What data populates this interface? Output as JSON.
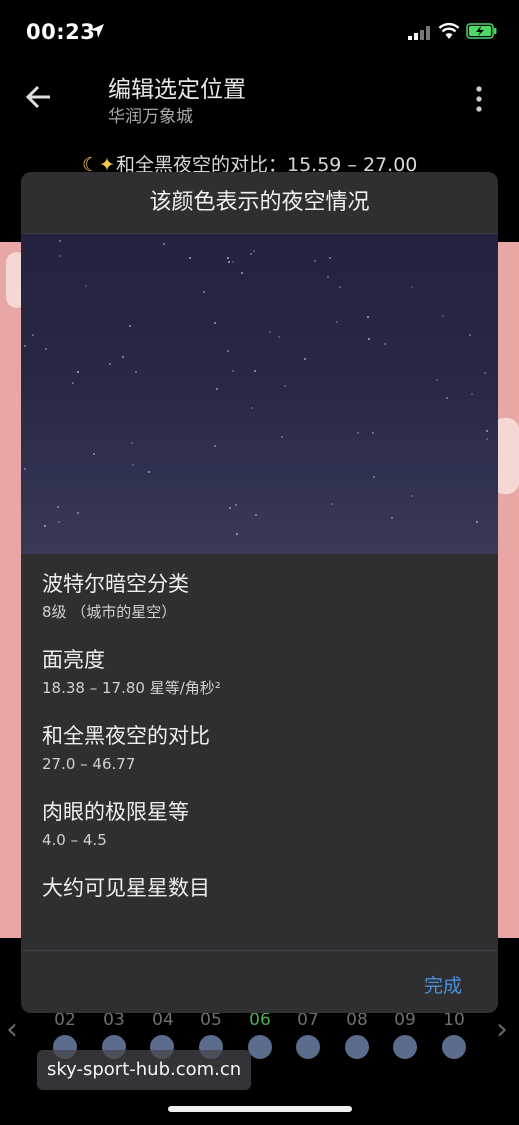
{
  "status_bar": {
    "time": "00:23",
    "icons": [
      "location-arrow-icon",
      "cellular-signal-icon",
      "wifi-icon",
      "battery-charging-icon"
    ],
    "battery_color": "#4cd964"
  },
  "header": {
    "title": "编辑选定位置",
    "subtitle": "华润万象城",
    "contrast_line": "和全黑夜空的对比：15.59 – 27.00",
    "moon_icon": "moon-stars-icon"
  },
  "dialog": {
    "title": "该颜色表示的夜空情况",
    "items": [
      {
        "label": "波特尔暗空分类",
        "value": "8级 （城市的星空）"
      },
      {
        "label": "面亮度",
        "value": "18.38 – 17.80 星等/角秒²"
      },
      {
        "label": "和全黑夜空的对比",
        "value": "27.0 – 46.77"
      },
      {
        "label": "肉眼的极限星等",
        "value": "4.0 – 4.5"
      },
      {
        "label": "大约可见星星数目",
        "value": ""
      }
    ],
    "done_label": "完成",
    "accent_color": "#4a90d9"
  },
  "timeline": {
    "dates": [
      "02",
      "03",
      "04",
      "05",
      "06",
      "07",
      "08",
      "09",
      "10"
    ],
    "highlight_index": 4,
    "highlight_color": "#4caf50"
  },
  "watermark": "sky-sport-hub.com.cn"
}
